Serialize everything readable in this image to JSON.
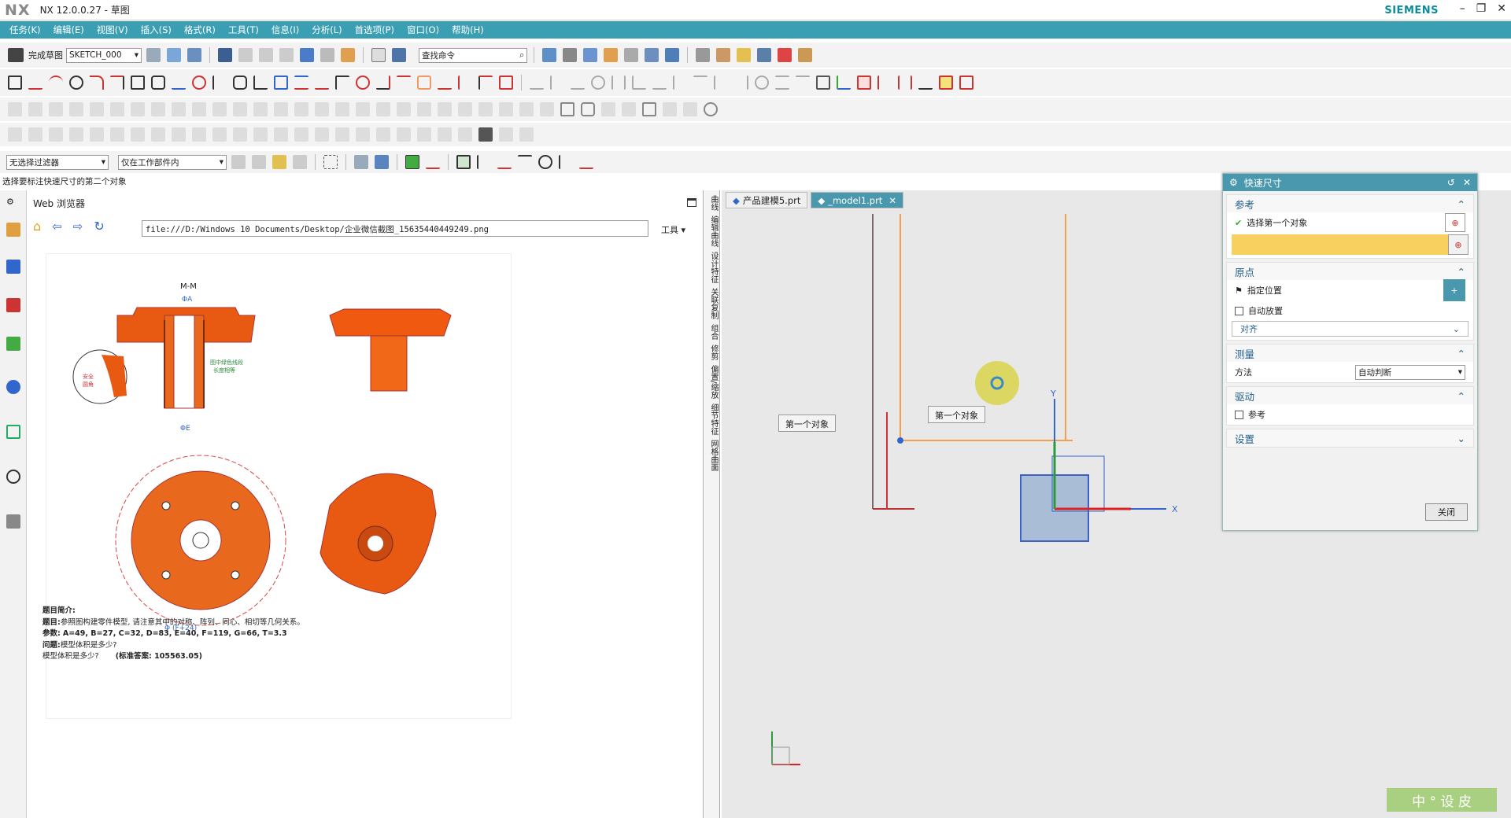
{
  "title": {
    "logo": "NX",
    "text": "NX 12.0.0.27 - 草图",
    "brand": "SIEMENS"
  },
  "menus": [
    "任务(K)",
    "编辑(E)",
    "视图(V)",
    "插入(S)",
    "格式(R)",
    "工具(T)",
    "信息(I)",
    "分析(L)",
    "首选项(P)",
    "窗口(O)",
    "帮助(H)"
  ],
  "toolbar1": {
    "finish_sketch": "完成草图",
    "sketch_name": "SKETCH_000",
    "search_placeholder": "查找命令"
  },
  "toolbar5": {
    "filter": "无选择过滤器",
    "scope": "仅在工作部件内"
  },
  "status": "选择要标注快速尺寸的第二个对象",
  "web": {
    "title": "Web 浏览器",
    "url": "file:///D:/Windows 10 Documents/Desktop/企业微信截图_15635440449249.png",
    "tools": "工具"
  },
  "drawing": {
    "section": "M-M",
    "phiA": "ΦA",
    "phiE": "ΦE",
    "phiF24": "Φ (F+24)",
    "note1": "图中绿色线段",
    "note2": "长度相等",
    "safe": "安全",
    "ver": "圆角"
  },
  "problem": {
    "h": "题目简介:",
    "l1_label": "题目:",
    "l1": "参照图构建零件模型, 请注意其中的对称、阵列、同心、相切等几何关系。",
    "l2_label": "参数:",
    "l2": "A=49, B=27, C=32, D=83, E=40, F=119, G=66, T=3.3",
    "l3_label": "问题:",
    "l3": "模型体积是多少?",
    "l4": "模型体积是多少?",
    "ans": "(标准答案: 105563.05)"
  },
  "vtabs": [
    "曲线",
    "编辑曲线",
    "设计特征",
    "关联复制",
    "组合",
    "修剪",
    "偏置/缩放",
    "细节特征",
    "网格曲面"
  ],
  "tabs": [
    {
      "label": "产品建模5.prt"
    },
    {
      "label": "_model1.prt"
    }
  ],
  "canvas": {
    "label1": "第一个对象",
    "label2": "第一个对象",
    "x": "X",
    "y": "Y"
  },
  "dialog": {
    "title": "快速尺寸",
    "s_ref": "参考",
    "ref1": "选择第一个对象",
    "s_origin": "原点",
    "origin_pos": "指定位置",
    "auto_place": "自动放置",
    "align": "对齐",
    "s_measure": "测量",
    "method_label": "方法",
    "method": "自动判断",
    "s_drive": "驱动",
    "ref_chk": "参考",
    "s_settings": "设置",
    "close": "关闭"
  },
  "watermark": "中 ° 设 皮"
}
